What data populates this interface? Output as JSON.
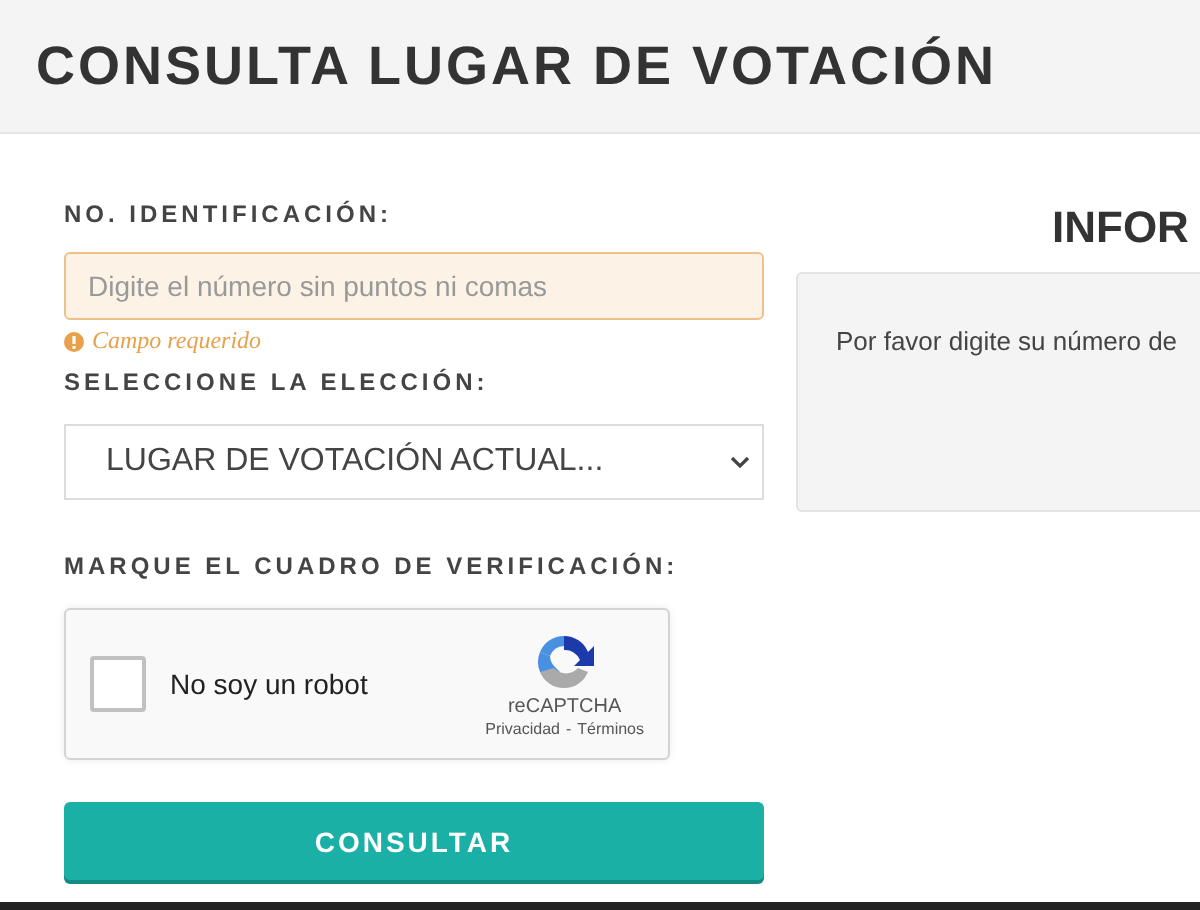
{
  "header": {
    "title": "CONSULTA LUGAR DE VOTACIÓN"
  },
  "form": {
    "id_label": "NO. IDENTIFICACIÓN:",
    "id_field": {
      "placeholder": "Digite el número sin puntos ni comas",
      "invalid": true,
      "error": "Campo requerido"
    },
    "election_label": "SELECCIONE LA ELECCIÓN:",
    "election_select": {
      "value": "LUGAR DE VOTACIÓN ACTUAL..."
    },
    "captcha_label": "MARQUE EL CUADRO DE VERIFICACIÓN:",
    "captcha": {
      "label": "No soy un robot",
      "checked": false,
      "brand": "reCAPTCHA",
      "privacy": "Privacidad",
      "separator": "-",
      "terms": "Términos"
    },
    "submit": "CONSULTAR"
  },
  "info": {
    "title": "INFOR",
    "message": "Por favor digite su número de"
  }
}
